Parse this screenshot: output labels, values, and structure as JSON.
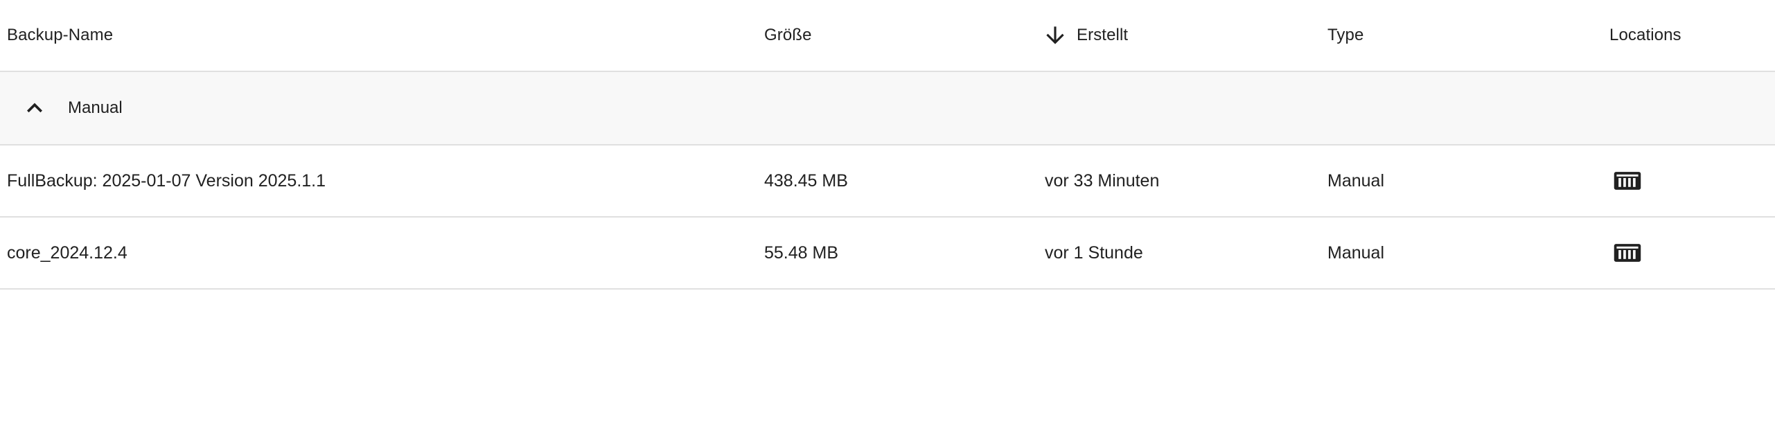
{
  "table": {
    "columns": {
      "name": "Backup-Name",
      "size": "Größe",
      "created": "Erstellt",
      "type": "Type",
      "locations": "Locations"
    },
    "sort": {
      "column": "created",
      "direction": "descending",
      "icon": "arrow-down-icon"
    },
    "group": {
      "label": "Manual",
      "expanded": true,
      "toggle_icon": "chevron-up-icon"
    },
    "rows": [
      {
        "name": "FullBackup: 2025-01-07 Version 2025.1.1",
        "size": "438.45 MB",
        "created": "vor 33 Minuten",
        "type": "Manual",
        "location_icon": "nas-storage-icon"
      },
      {
        "name": "core_2024.12.4",
        "size": "55.48 MB",
        "created": "vor 1 Stunde",
        "type": "Manual",
        "location_icon": "nas-storage-icon"
      }
    ]
  }
}
